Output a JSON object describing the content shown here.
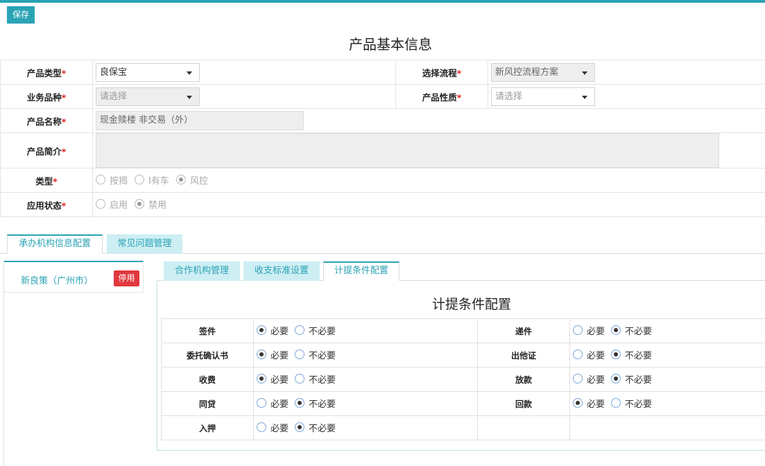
{
  "toolbar": {
    "save_label": "保存"
  },
  "page_title": "产品基本信息",
  "form": {
    "product_type": {
      "label": "产品类型",
      "value": "良保宝"
    },
    "process": {
      "label": "选择流程",
      "value": "新风控流程方案"
    },
    "business_variety": {
      "label": "业务品种",
      "placeholder": "请选择"
    },
    "product_nature": {
      "label": "产品性质",
      "placeholder": "请选择"
    },
    "product_name": {
      "label": "产品名称",
      "value": "现金赎楼 非交易（外）"
    },
    "product_intro": {
      "label": "产品简介",
      "value": ""
    },
    "kind": {
      "label": "类型",
      "options": [
        "按揭",
        "I有车",
        "风控"
      ],
      "selected": "风控"
    },
    "status": {
      "label": "应用状态",
      "options": [
        "启用",
        "禁用"
      ],
      "selected": "禁用"
    },
    "required_mark": "*"
  },
  "main_tabs": [
    {
      "label": "承办机构信息配置",
      "active": true
    },
    {
      "label": "常见问题管理",
      "active": false
    }
  ],
  "org_list": [
    {
      "name": "新良策（广州市）",
      "badge": "停用"
    }
  ],
  "sub_tabs": [
    {
      "label": "合作机构管理",
      "active": false
    },
    {
      "label": "收支标准设置",
      "active": false
    },
    {
      "label": "计提条件配置",
      "active": true
    }
  ],
  "conditions": {
    "title": "计提条件配置",
    "option_required": "必要",
    "option_not_required": "不必要",
    "left": [
      {
        "label": "签件",
        "value": "必要"
      },
      {
        "label": "委托确认书",
        "value": "必要"
      },
      {
        "label": "收费",
        "value": "必要"
      },
      {
        "label": "同贷",
        "value": "不必要"
      },
      {
        "label": "入押",
        "value": "不必要"
      }
    ],
    "right": [
      {
        "label": "递件",
        "value": "不必要"
      },
      {
        "label": "出他证",
        "value": "不必要"
      },
      {
        "label": "放款",
        "value": "不必要"
      },
      {
        "label": "回款",
        "value": "必要"
      }
    ]
  },
  "colors": {
    "accent": "#2aa3b5",
    "danger": "#e0393e",
    "required": "#e02020"
  }
}
